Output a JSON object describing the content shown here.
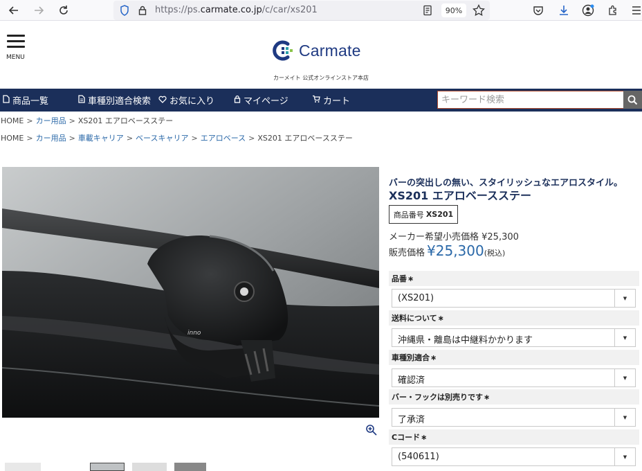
{
  "browser": {
    "url_prefix": "https://ps.",
    "url_domain": "carmate.co.jp",
    "url_path": "/c/car/xs201",
    "zoom": "90%"
  },
  "header": {
    "menu_label": "MENU",
    "logo_text": "Carmate",
    "tagline": "カーメイト 公式オンラインストア本店"
  },
  "nav": {
    "items": [
      {
        "label": "商品一覧",
        "icon": "file-icon"
      },
      {
        "label": "車種別適合検索",
        "icon": "document-icon"
      },
      {
        "label": "お気に入り",
        "icon": "heart-icon"
      },
      {
        "label": "マイページ",
        "icon": "lock-icon"
      },
      {
        "label": "カート",
        "icon": "cart-icon"
      }
    ],
    "search_placeholder": "キーワード検索"
  },
  "breadcrumb1": [
    "HOME",
    "カー用品",
    "XS201 エアロベースステー"
  ],
  "breadcrumb2": [
    "HOME",
    "カー用品",
    "車載キャリア",
    "ベースキャリア",
    "エアロベース",
    "XS201 エアロベースステー"
  ],
  "product": {
    "catchcopy": "バーの突出しの無い、スタイリッシュなエアロスタイル。",
    "title": "XS201 エアロベースステー",
    "code_label": "商品番号",
    "code": "XS201",
    "msrp": "メーカー希望小売価格 ¥25,300",
    "sale_label": "販売価格",
    "sale_price": "¥25,300",
    "tax_note": "(税込)",
    "image_badge": "inno"
  },
  "options": [
    {
      "label": "品番",
      "value": "(XS201)"
    },
    {
      "label": "送料について",
      "value": "沖縄県・離島は中継料かかります"
    },
    {
      "label": "車種別適合",
      "value": "確認済"
    },
    {
      "label": "バー・フックは別売りです",
      "value": "了承済"
    },
    {
      "label": "Cコード",
      "value": "(540611)"
    }
  ],
  "required_mark": "∗",
  "colors": {
    "navy": "#1b2f5a",
    "link": "#2a68a8"
  }
}
